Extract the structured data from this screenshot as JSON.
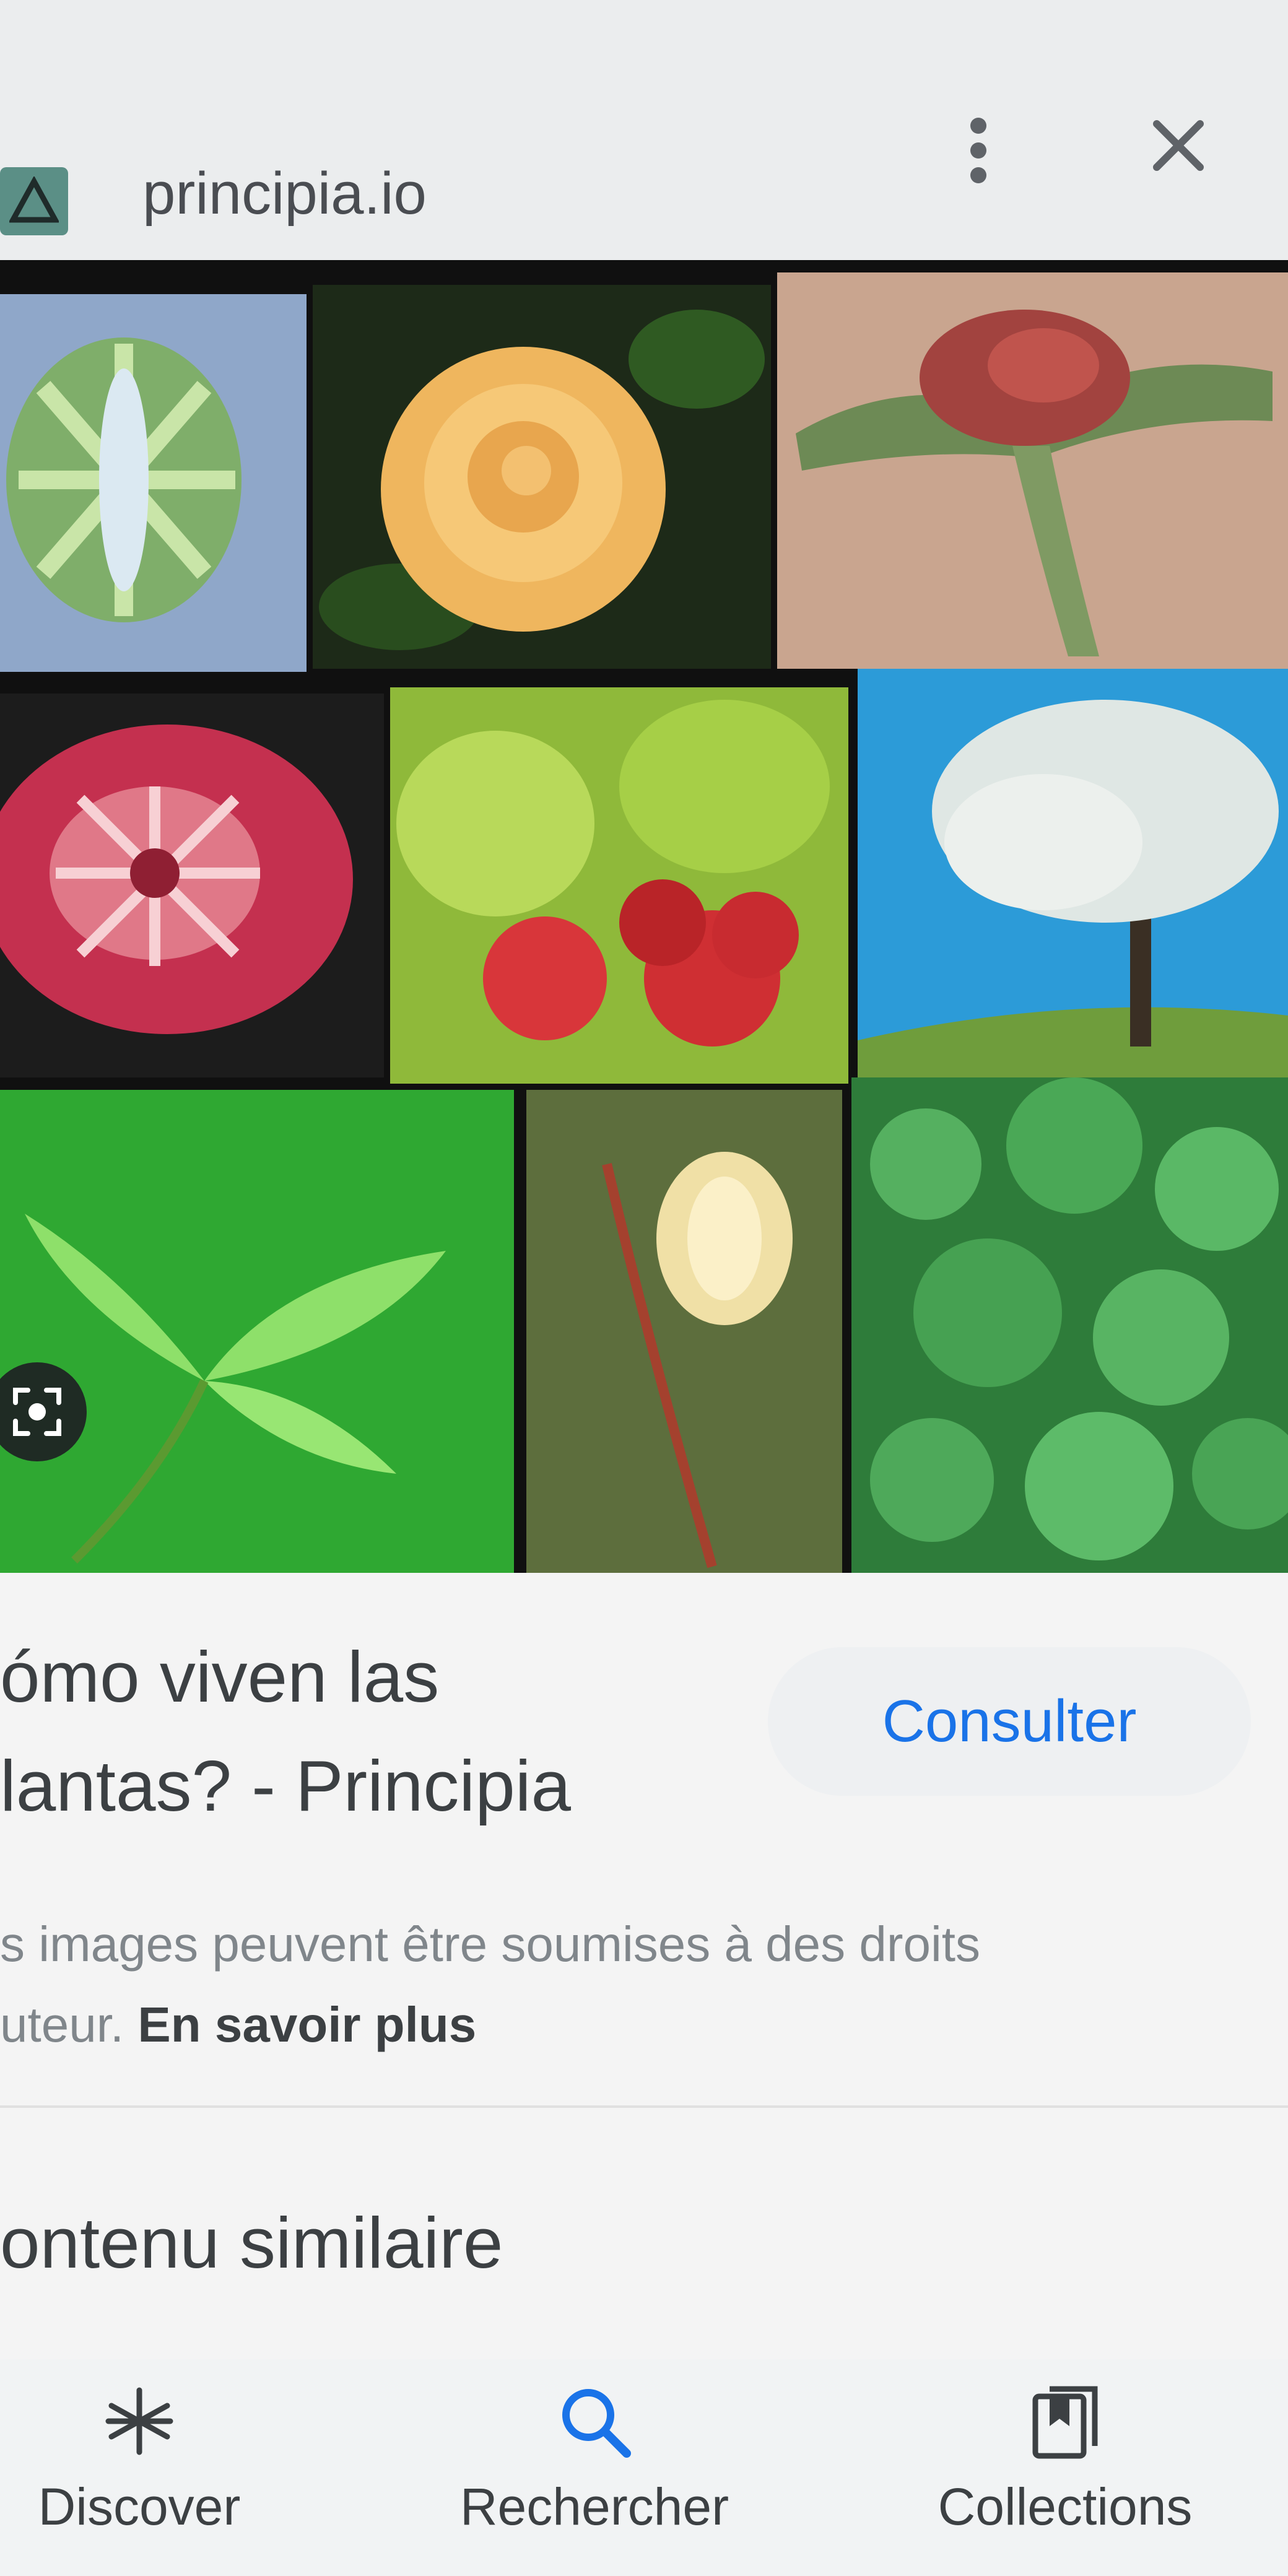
{
  "header": {
    "site_url": "principia.io",
    "site_icon": "triangle-logo-icon",
    "menu_icon": "more-vert-icon",
    "close_icon": "close-icon"
  },
  "image_grid": {
    "tiles": [
      "desmid-alga-image",
      "yellow-rose-image",
      "welwitschia-plant-image",
      "sundew-plant-image",
      "raspberries-image",
      "flowering-tree-image",
      "ginkgo-leaves-image",
      "willow-catkin-image",
      "liverwort-moss-image"
    ]
  },
  "lens_button": {
    "icon": "lens-icon"
  },
  "result": {
    "title_line1": "ómo viven las",
    "title_line2": "lantas? - Principia",
    "consult_label": "Consulter",
    "notice_line1": "s images peuvent être soumises à des droits",
    "notice_line2": "uteur. ",
    "learn_more": "En savoir plus"
  },
  "similar": {
    "heading": "ontenu similaire"
  },
  "bottom_nav": {
    "items": [
      {
        "label": "Discover",
        "icon": "asterisk-icon"
      },
      {
        "label": "Rechercher",
        "icon": "search-icon"
      },
      {
        "label": "Collections",
        "icon": "collections-icon"
      }
    ]
  },
  "colors": {
    "accent": "#1a73e8",
    "text": "#3c4043",
    "muted": "#80868b",
    "background": "#f4f4f4"
  }
}
